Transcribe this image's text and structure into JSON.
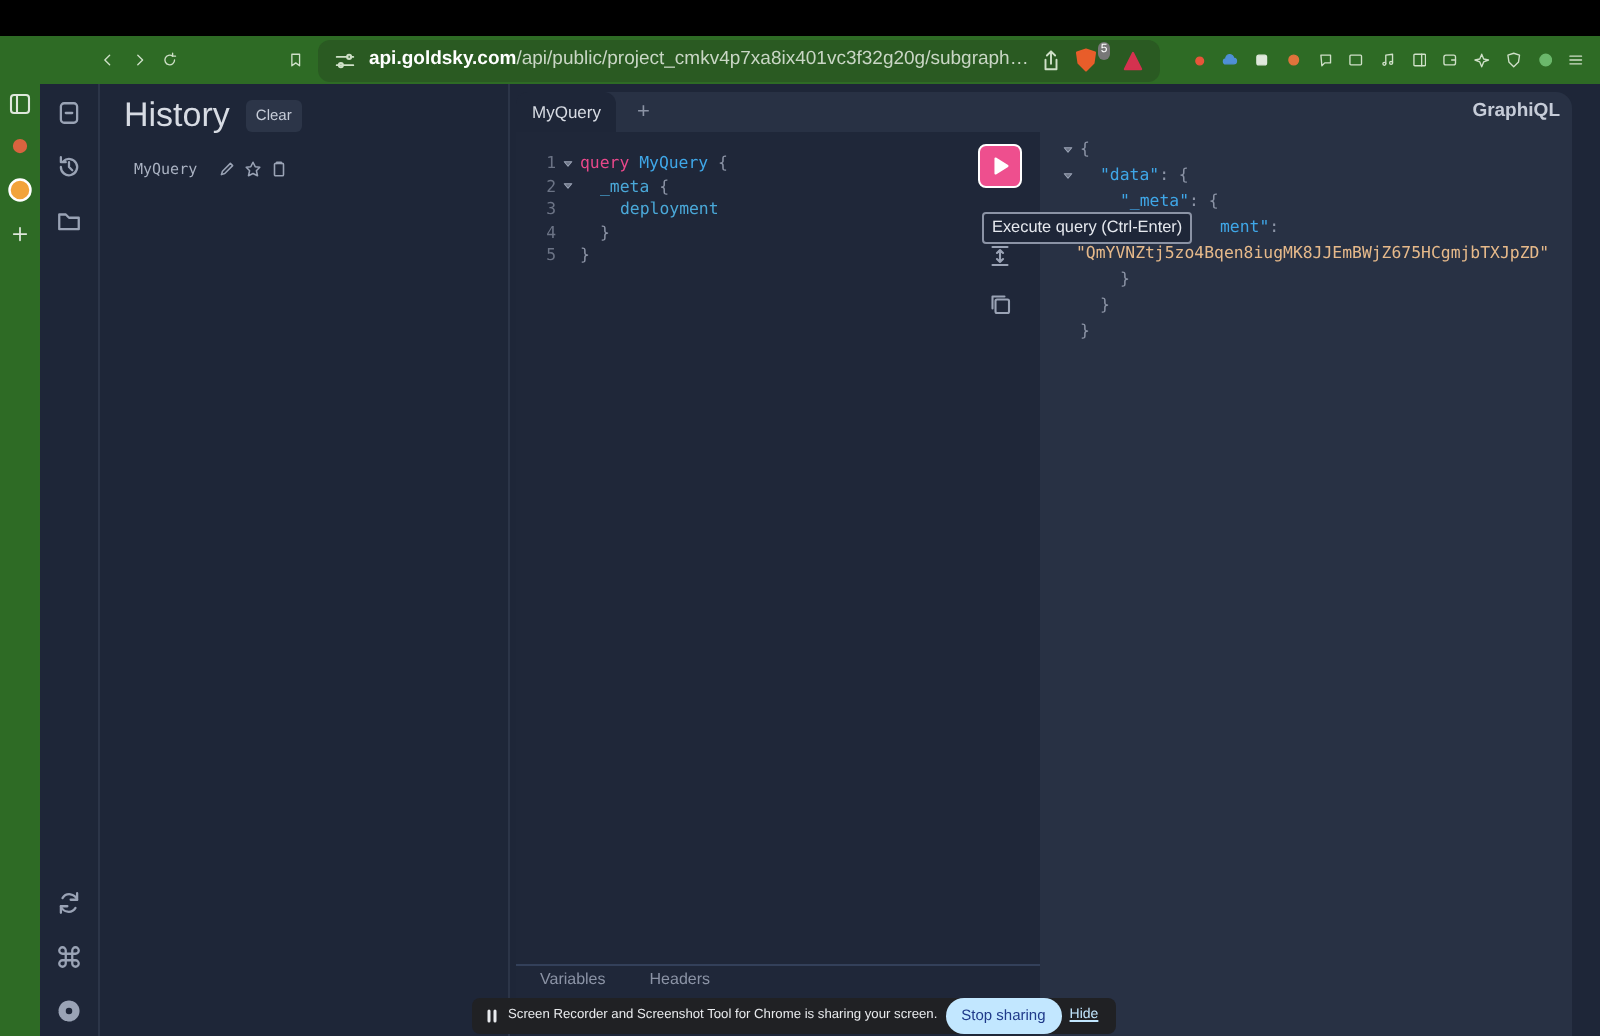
{
  "browser": {
    "url_host": "api.goldsky.com",
    "url_path": "/api/public/project_cmkv4p7xa8ix401vc3f32g20g/subgraph…",
    "shield_count": "5"
  },
  "history": {
    "title": "History",
    "clear": "Clear",
    "items": [
      {
        "label": "MyQuery"
      }
    ]
  },
  "tabs": [
    {
      "label": "MyQuery",
      "selected": true
    }
  ],
  "add_tab": "+",
  "brand": "GraphiQL",
  "editor": {
    "lines": [
      {
        "number": "1",
        "fold": true,
        "tokens": [
          {
            "kind": "keyword",
            "text": "query"
          },
          {
            "kind": "name",
            "text": "MyQuery"
          },
          {
            "kind": "punct",
            "text": "{"
          }
        ],
        "children": [
          {
            "number": "2",
            "fold": true,
            "tokens": [
              {
                "kind": "field",
                "text": "_meta"
              },
              {
                "kind": "punct",
                "text": "{"
              }
            ],
            "children": [
              {
                "number": "3",
                "fold": false,
                "tokens": [
                  {
                    "kind": "field",
                    "text": "deployment"
                  }
                ]
              }
            ]
          },
          {
            "number": "4",
            "fold": false,
            "tokens": [
              {
                "kind": "punct",
                "text": "}"
              }
            ]
          }
        ]
      },
      {
        "number": "5",
        "fold": false,
        "tokens": [
          {
            "kind": "punct",
            "text": "}"
          }
        ]
      }
    ]
  },
  "tooltip": "Execute query (Ctrl-Enter)",
  "result": {
    "lines": [
      {
        "fold": true,
        "tokens": [
          {
            "kind": "punct",
            "text": "{"
          }
        ],
        "children": [
          {
            "fold": true,
            "tokens": [
              {
                "kind": "key",
                "text": "\"data\""
              },
              {
                "kind": "punct",
                "text": ": {"
              }
            ],
            "children": [
              {
                "fold": false,
                "tokens": [
                  {
                    "kind": "key",
                    "text": "\"_meta\""
                  },
                  {
                    "kind": "punct",
                    "text": ": {"
                  }
                ],
                "children": [
                  {
                    "fold": false,
                    "kind": "covered",
                    "tokens": [
                      {
                        "kind": "key",
                        "text": "ment\""
                      },
                      {
                        "kind": "punct",
                        "text": ":"
                      }
                    ]
                  },
                  {
                    "fold": false,
                    "kind": "wrapped",
                    "tokens": [
                      {
                        "kind": "string",
                        "text": "\"QmYVNZtj5zo4Bqen8iugMK8JJEmBWjZ675HCgmjbTXJpZD\""
                      }
                    ]
                  }
                ]
              },
              {
                "fold": false,
                "tokens": [
                  {
                    "kind": "punct",
                    "text": "}"
                  }
                ]
              }
            ]
          },
          {
            "fold": false,
            "tokens": [
              {
                "kind": "punct",
                "text": "}"
              }
            ]
          }
        ]
      },
      {
        "fold": false,
        "tokens": [
          {
            "kind": "punct",
            "text": "}"
          }
        ]
      }
    ]
  },
  "bottom_tabs": [
    {
      "label": "Variables"
    },
    {
      "label": "Headers"
    }
  ],
  "share_bar": {
    "message": "Screen Recorder and Screenshot Tool for Chrome is sharing your screen.",
    "stop": "Stop sharing",
    "hide": "Hide"
  }
}
